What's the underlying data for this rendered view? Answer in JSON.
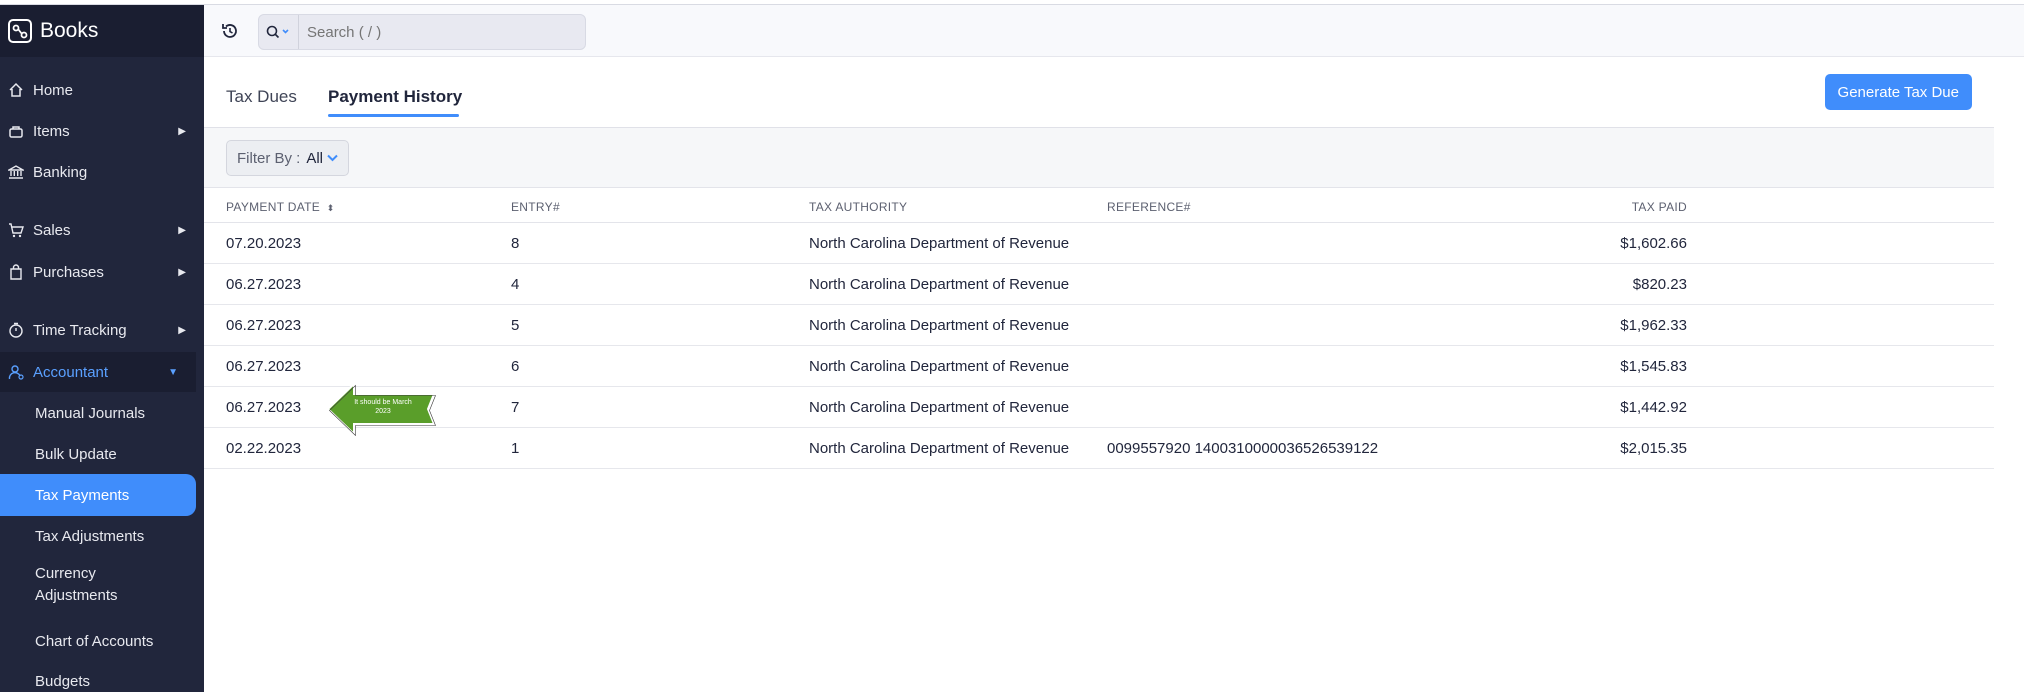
{
  "app": {
    "name": "Books"
  },
  "search": {
    "placeholder": "Search ( / )"
  },
  "sidebar": {
    "items": [
      {
        "label": "Home",
        "icon": "home-icon"
      },
      {
        "label": "Items",
        "icon": "basket-icon"
      },
      {
        "label": "Banking",
        "icon": "bank-icon"
      },
      {
        "label": "Sales",
        "icon": "cart-icon"
      },
      {
        "label": "Purchases",
        "icon": "bag-icon"
      },
      {
        "label": "Time Tracking",
        "icon": "timer-icon"
      },
      {
        "label": "Accountant",
        "icon": "accountant-icon"
      }
    ],
    "subitems": [
      {
        "label": "Manual Journals"
      },
      {
        "label": "Bulk Update"
      },
      {
        "label": "Tax Payments"
      },
      {
        "label": "Tax Adjustments"
      },
      {
        "label": "Currency Adjustments"
      },
      {
        "label": "Chart of Accounts"
      },
      {
        "label": "Budgets"
      }
    ]
  },
  "tabs": [
    {
      "label": "Tax Dues"
    },
    {
      "label": "Payment History"
    }
  ],
  "actions": {
    "generate": "Generate Tax Due"
  },
  "filter": {
    "label": "Filter By :",
    "value": "All"
  },
  "table": {
    "headers": [
      "PAYMENT DATE",
      "ENTRY#",
      "TAX AUTHORITY",
      "REFERENCE#",
      "TAX PAID"
    ],
    "rows": [
      [
        "07.20.2023",
        "8",
        "North Carolina Department of Revenue",
        "",
        "$1,602.66"
      ],
      [
        "06.27.2023",
        "4",
        "North Carolina Department of Revenue",
        "",
        "$820.23"
      ],
      [
        "06.27.2023",
        "5",
        "North Carolina Department of Revenue",
        "",
        "$1,962.33"
      ],
      [
        "06.27.2023",
        "6",
        "North Carolina Department of Revenue",
        "",
        "$1,545.83"
      ],
      [
        "06.27.2023",
        "7",
        "North Carolina Department of Revenue",
        "",
        "$1,442.92"
      ],
      [
        "02.22.2023",
        "1",
        "North Carolina Department of Revenue",
        "0099557920 140031000003652653912​2",
        "$2,015.35"
      ]
    ]
  },
  "annotation": {
    "text": "It should be March 2023"
  },
  "colors": {
    "accent": "#408dfb",
    "sidebar": "#21263c",
    "annotation": "#5a9e2a"
  }
}
